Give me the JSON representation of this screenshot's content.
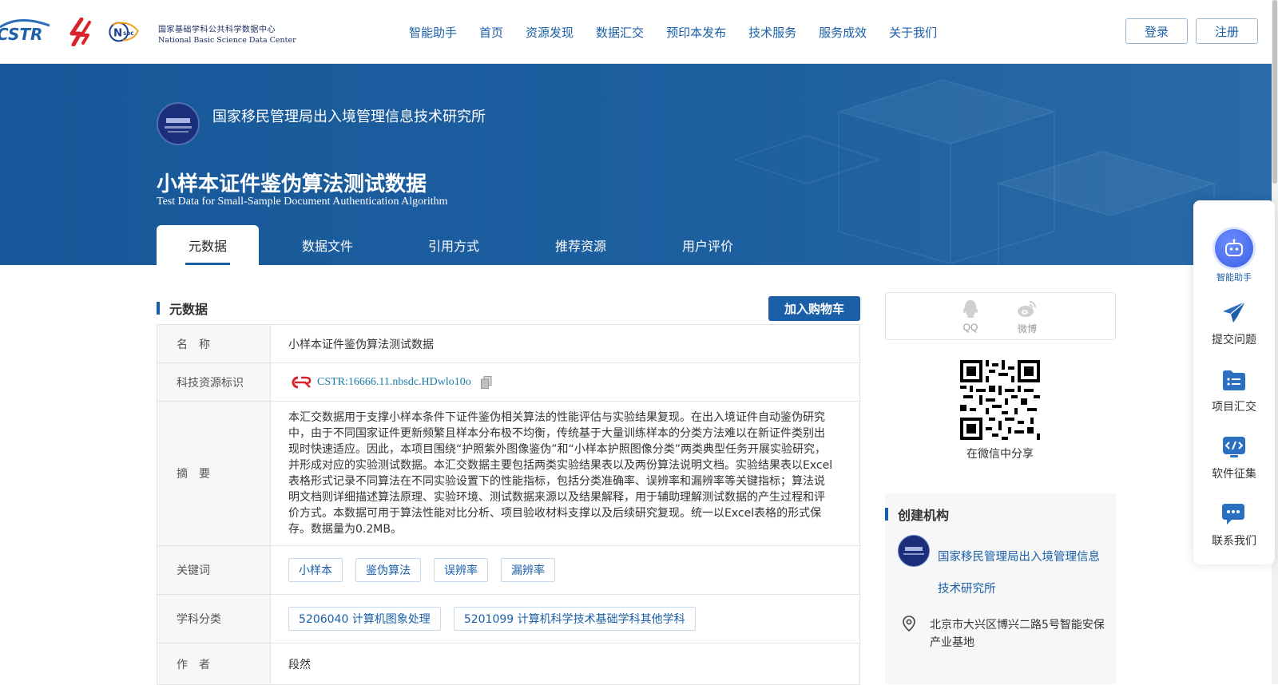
{
  "nav": {
    "logo_cstr_text": "CSTR",
    "logo_nsdc_text": "NSDC",
    "logo_nsdc_cn": "国家基础学科公共科学数据中心",
    "logo_nsdc_en": "National Basic Science Data Center",
    "items": [
      "智能助手",
      "首页",
      "资源发现",
      "数据汇交",
      "预印本发布",
      "技术服务",
      "服务成效",
      "关于我们"
    ],
    "login": "登录",
    "register": "注册"
  },
  "banner": {
    "org_name": "国家移民管理局出入境管理信息技术研究所",
    "title": "小样本证件鉴伪算法测试数据",
    "subtitle": "Test Data for Small-Sample Document Authentication Algorithm",
    "tabs": [
      "元数据",
      "数据文件",
      "引用方式",
      "推荐资源",
      "用户评价"
    ],
    "active_tab": "元数据"
  },
  "metadata": {
    "section_title": "元数据",
    "cart_button": "加入购物车",
    "labels": {
      "name": "名　称",
      "cstr": "科技资源标识",
      "abstract": "摘　要",
      "keywords": "关键词",
      "subject": "学科分类",
      "author": "作　者"
    },
    "name": "小样本证件鉴伪算法测试数据",
    "cstr": "CSTR:16666.11.nbsdc.HDwlo10o",
    "abstract": "本汇交数据用于支撑小样本条件下证件鉴伪相关算法的性能评估与实验结果复现。在出入境证件自动鉴伪研究中，由于不同国家证件更新频繁且样本分布极不均衡，传统基于大量训练样本的分类方法难以在新证件类别出现时快速适应。因此，本项目围绕“护照紫外图像鉴伪”和“小样本护照图像分类”两类典型任务开展实验研究，并形成对应的实验测试数据。本汇交数据主要包括两类实验结果表以及两份算法说明文档。实验结果表以Excel表格形式记录不同算法在不同实验设置下的性能指标，包括分类准确率、误辨率和漏辨率等关键指标；算法说明文档则详细描述算法原理、实验环境、测试数据来源以及结果解释，用于辅助理解测试数据的产生过程和评价方式。本数据可用于算法性能对比分析、项目验收材料支撑以及后续研究复现。统一以Excel表格的形式保存。数据量为0.2MB。",
    "keywords": [
      "小样本",
      "鉴伪算法",
      "误辨率",
      "漏辨率"
    ],
    "subjects": [
      "5206040 计算机图象处理",
      "5201099 计算机科学技术基础学科其他学科"
    ],
    "author": "段然"
  },
  "share": {
    "qq": "QQ",
    "weibo": "微博",
    "wechat_caption": "在微信中分享"
  },
  "creator": {
    "section_title": "创建机构",
    "org_link": "国家移民管理局出入境管理信息技术研究所",
    "address": "北京市大兴区博兴二路5号智能安保产业基地"
  },
  "float_panel": {
    "assistant": "智能助手",
    "submit_issue": "提交问题",
    "project_collect": "项目汇交",
    "software_collect": "软件征集",
    "contact": "联系我们"
  },
  "colors": {
    "primary": "#1a5fa8",
    "banner": "#1c5f9f",
    "cstr_red": "#d6242a"
  }
}
